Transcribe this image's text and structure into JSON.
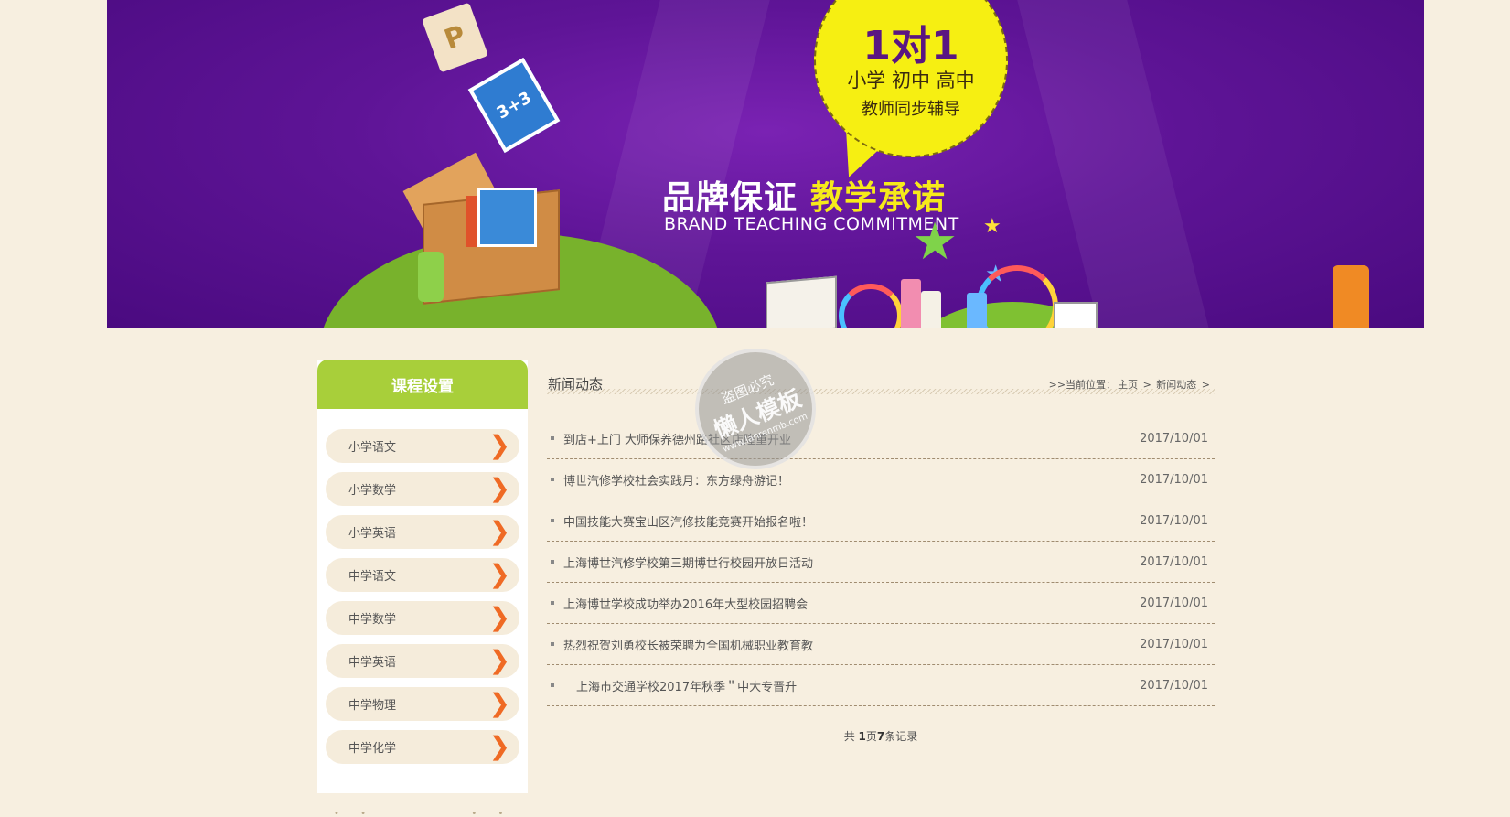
{
  "banner": {
    "bubble_title": "1对1",
    "bubble_levels": "小学 初中 高中",
    "bubble_sub": "教师同步辅导",
    "slogan_white": "品牌保证",
    "slogan_yellow": "教学承诺",
    "slogan_en": "BRAND TEACHING COMMITMENT",
    "card_label": "3+3",
    "p_label": "P",
    "colors": {
      "bg": "#5e1496",
      "bubble": "#f6ef12",
      "accent": "#f6ea1a"
    }
  },
  "sidebar": {
    "title": "课程设置",
    "items": [
      {
        "label": "小学语文"
      },
      {
        "label": "小学数学"
      },
      {
        "label": "小学英语"
      },
      {
        "label": "中学语文"
      },
      {
        "label": "中学数学"
      },
      {
        "label": "中学英语"
      },
      {
        "label": "中学物理"
      },
      {
        "label": "中学化学"
      }
    ],
    "arrow_icon": "chevron-right-icon",
    "colors": {
      "header": "#a8cf3a",
      "arrow": "#ef6a24"
    }
  },
  "main": {
    "title": "新闻动态",
    "breadcrumb": {
      "prefix": ">>当前位置：",
      "home": "主页",
      "sep1": ">",
      "current": "新闻动态",
      "sep2": ">"
    },
    "news": [
      {
        "title": "到店+上门 大师保养德州路社区店隆重开业",
        "date": "2017/10/01"
      },
      {
        "title": "博世汽修学校社会实践月：东方绿舟游记！",
        "date": "2017/10/01"
      },
      {
        "title": "中国技能大赛宝山区汽修技能竞赛开始报名啦！",
        "date": "2017/10/01"
      },
      {
        "title": "上海博世汽修学校第三期博世行校园开放日活动",
        "date": "2017/10/01"
      },
      {
        "title": "上海博世学校成功举办2016年大型校园招聘会",
        "date": "2017/10/01"
      },
      {
        "title": "热烈祝贺刘勇校长被荣聘为全国机械职业教育教",
        "date": "2017/10/01"
      },
      {
        "title": "上海市交通学校2017年秋季＂中大专晋升",
        "date": "2017/10/01"
      }
    ],
    "pager": {
      "pre": "共 ",
      "pages": "1",
      "mid": "页",
      "records": "7",
      "post": "条记录"
    }
  },
  "watermark": {
    "line1": "盗图必究",
    "line2": "懒人模板",
    "line3": "www.lanrenmb.com"
  }
}
